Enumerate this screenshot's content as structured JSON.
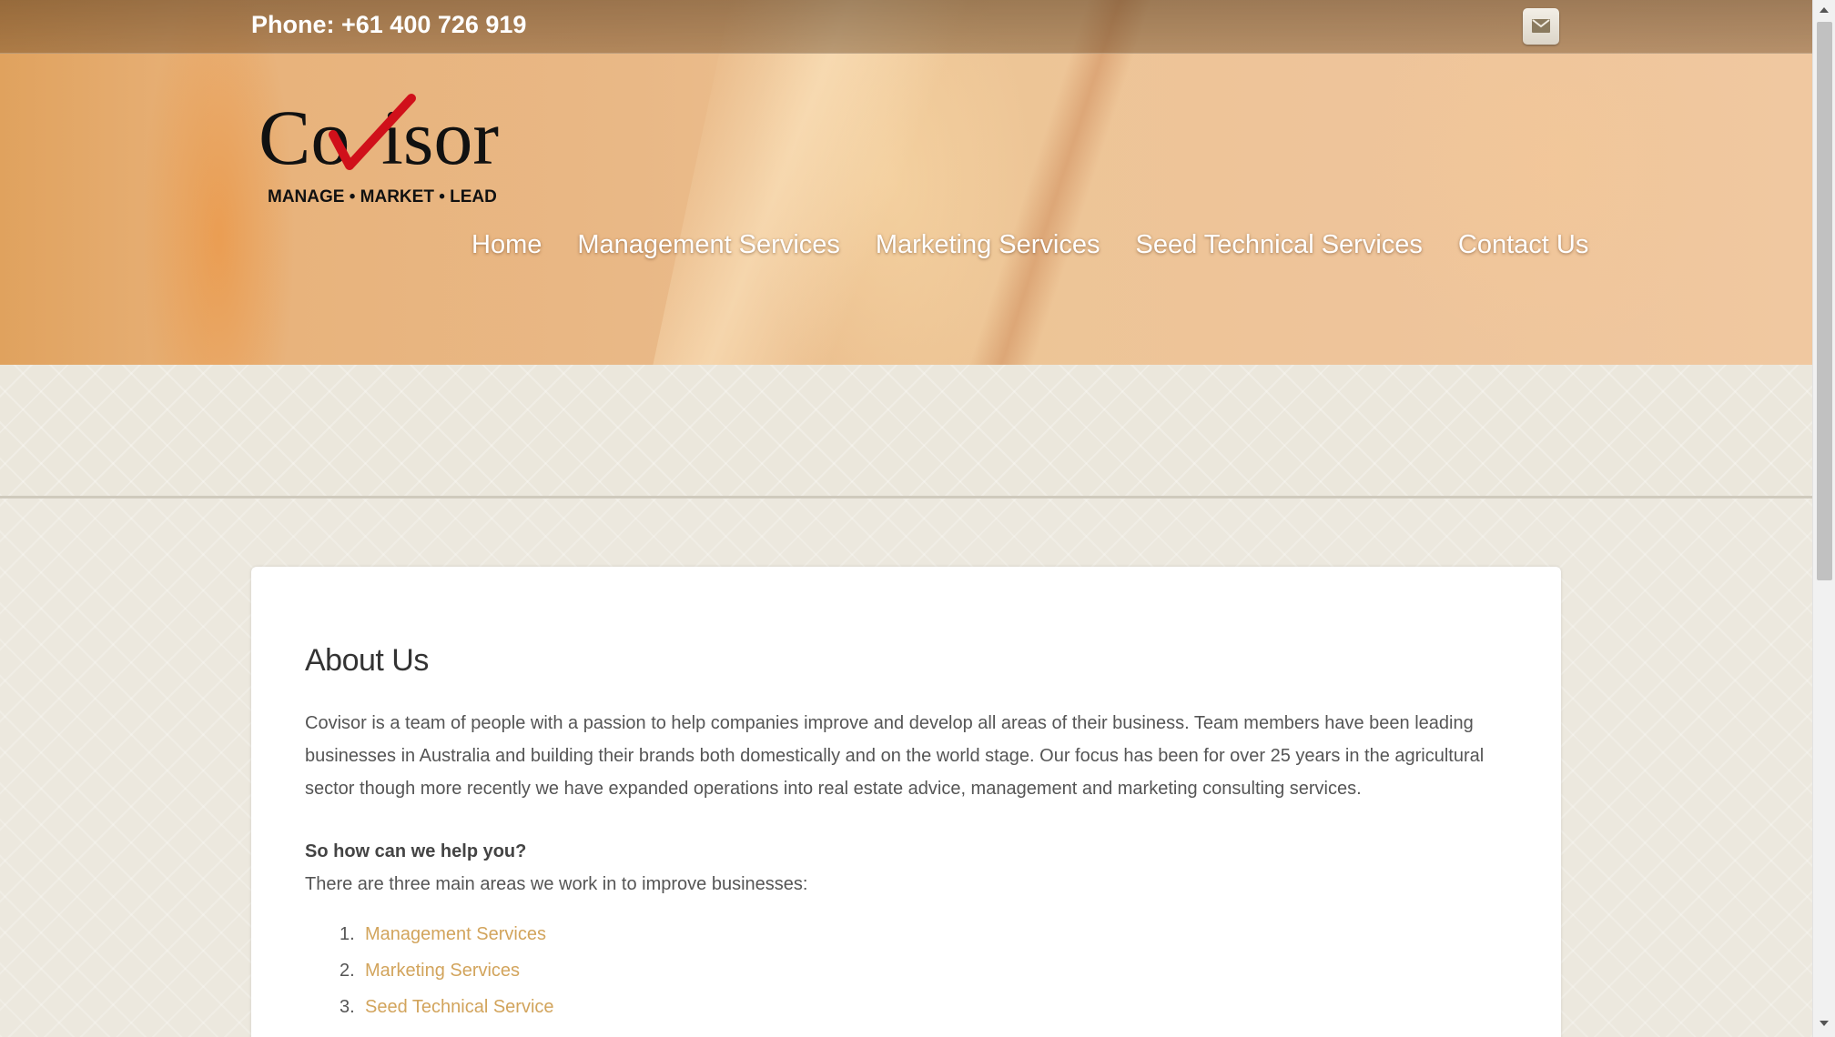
{
  "header": {
    "phone": "Phone: +61 400 726 919",
    "mail_icon": "mail-icon"
  },
  "logo": {
    "name_part1": "Co",
    "name_part2": "isor",
    "tagline": "MANAGE • MARKET • LEAD"
  },
  "nav": {
    "items": [
      {
        "label": "Home"
      },
      {
        "label": "Management Services"
      },
      {
        "label": "Marketing Services"
      },
      {
        "label": "Seed Technical Services"
      },
      {
        "label": "Contact Us"
      }
    ]
  },
  "main": {
    "title": "About Us",
    "paragraph": "Covisor is a team of people with a passion to help companies improve and develop all areas of their business. Team members have been leading businesses in Australia and building their brands both domestically and on the world stage. Our focus has been for over 25 years in the agricultural sector though more recently we have expanded operations into real estate advice, management and marketing consulting services.",
    "subheading": "So how can we help you?",
    "intro": "There are three main areas we work in to improve businesses:",
    "list": [
      {
        "num": "1.",
        "label": "Management Services"
      },
      {
        "num": "2.",
        "label": "Marketing Services"
      },
      {
        "num": "3.",
        "label": "Seed Technical Service"
      }
    ]
  },
  "colors": {
    "accent_link": "#d2a45c",
    "logo_check": "#d0101a",
    "text": "#555555"
  }
}
